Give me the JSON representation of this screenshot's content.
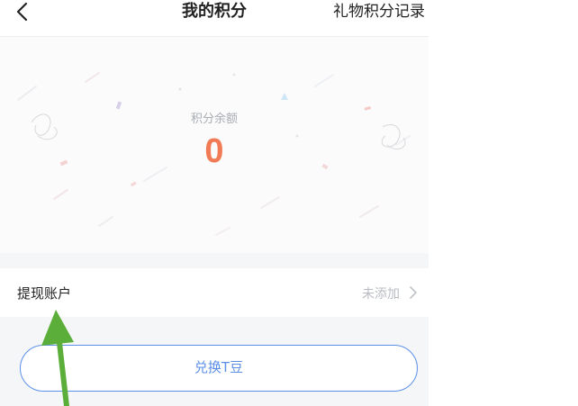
{
  "header": {
    "title": "我的积分",
    "right_link": "礼物积分记录"
  },
  "balance": {
    "label": "积分余额",
    "value": "0"
  },
  "withdraw_account": {
    "label": "提现账户",
    "status": "未添加"
  },
  "exchange_button": {
    "label": "兑换T豆"
  },
  "colors": {
    "accent_orange": "#f07b54",
    "button_blue": "#5b8fe8",
    "annotation_green": "#5cae3a"
  },
  "icons": {
    "back": "chevron-left-icon",
    "row_arrow": "chevron-right-icon"
  }
}
